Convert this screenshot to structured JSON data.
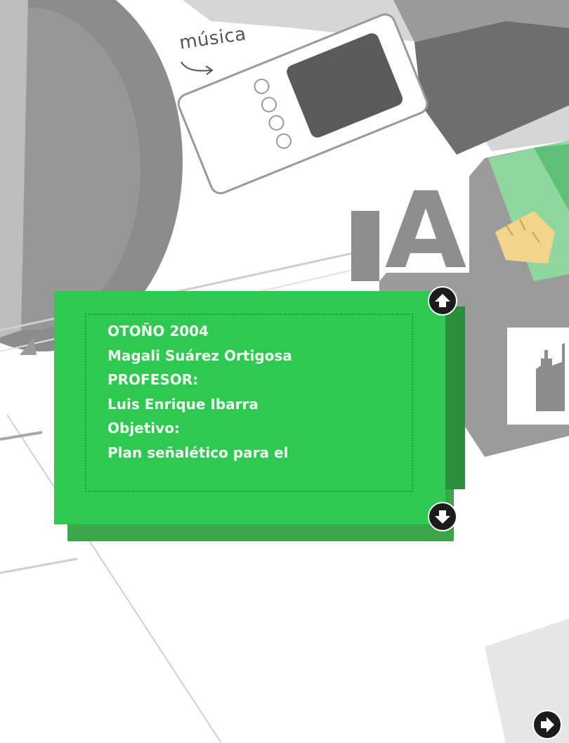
{
  "background": {
    "label_musica": "música",
    "letter": "A",
    "accent_green": "#2ec950",
    "accent_yellow": "#f2d48a"
  },
  "info_panel": {
    "lines": [
      "OTOÑO 2004",
      "Magali Suárez Ortigosa",
      "PROFESOR:",
      "Luis Enrique Ibarra",
      "Objetivo:",
      "Plan señalético para el"
    ],
    "scroll_up_icon": "arrow-up-icon",
    "scroll_down_icon": "arrow-down-icon"
  },
  "navigation": {
    "next_icon": "arrow-right-icon"
  }
}
